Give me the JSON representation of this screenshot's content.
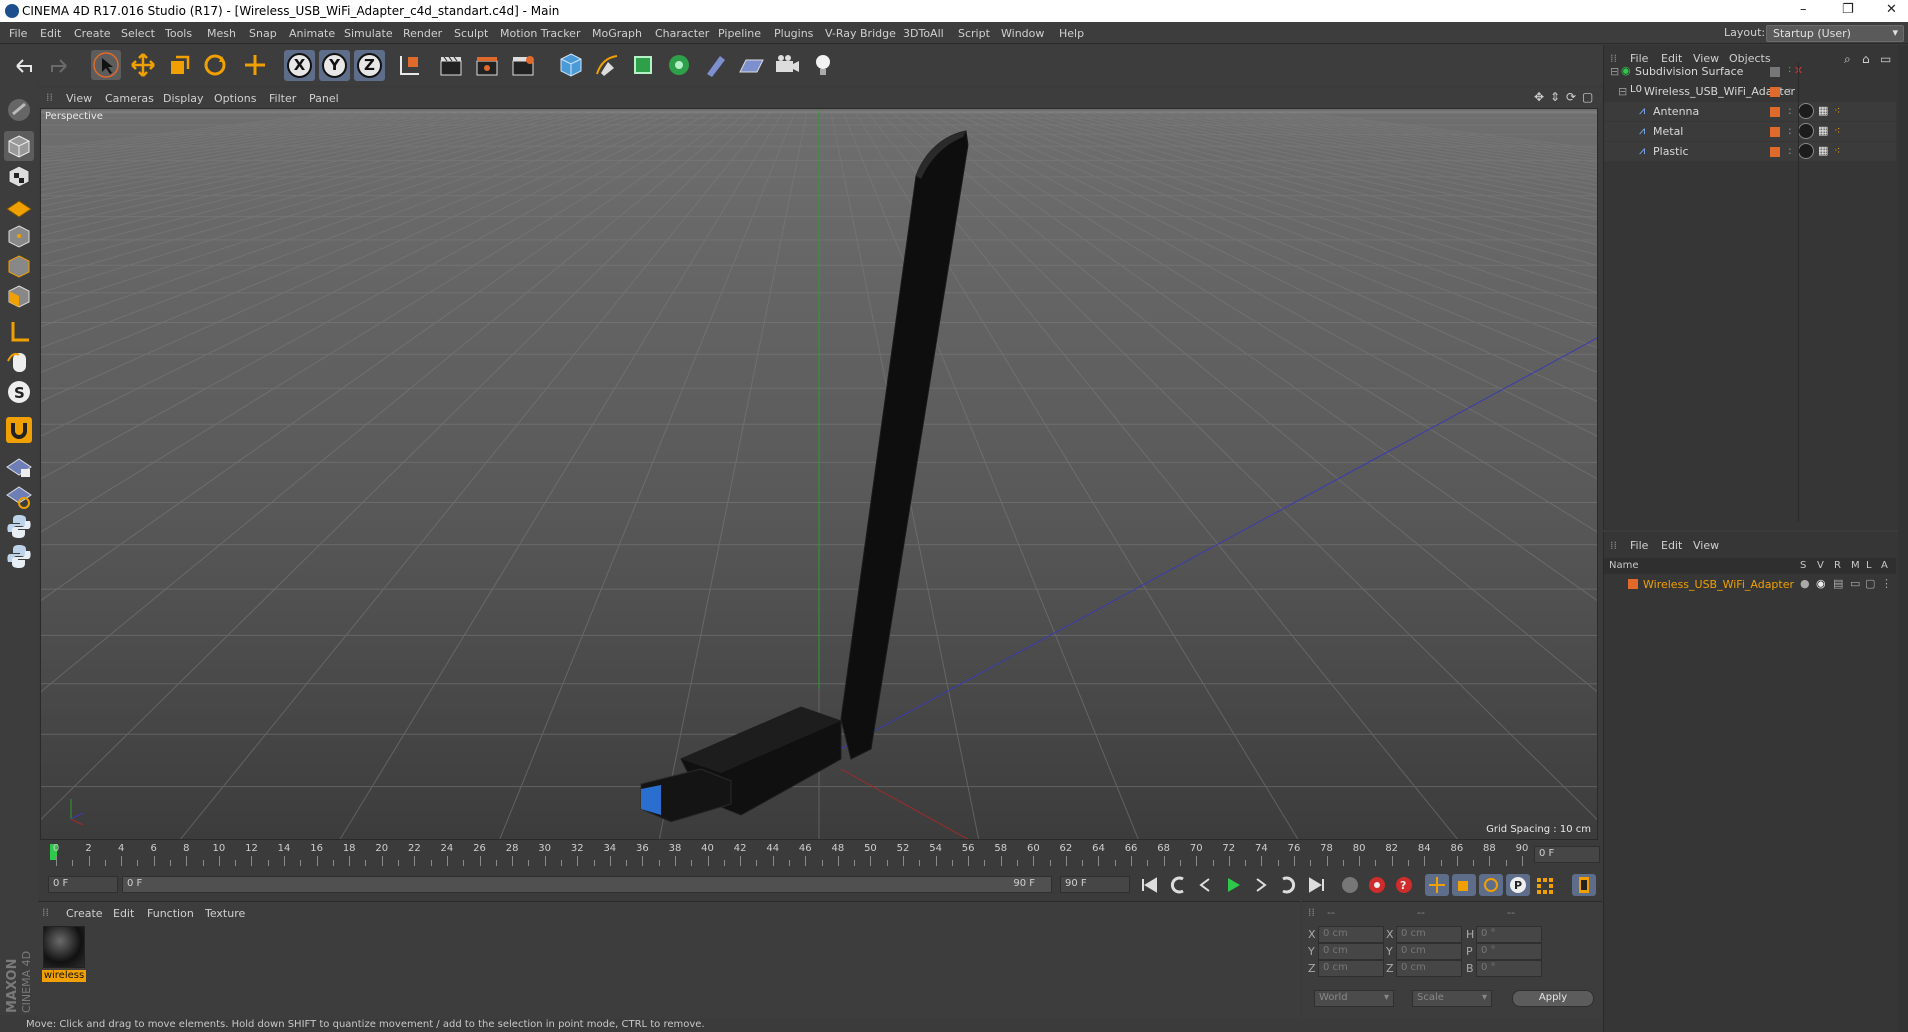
{
  "window": {
    "title": "CINEMA 4D R17.016 Studio (R17) - [Wireless_USB_WiFi_Adapter_c4d_standart.c4d] - Main",
    "controls": [
      "–",
      "❐",
      "✕"
    ]
  },
  "menu": [
    "File",
    "Edit",
    "Create",
    "Select",
    "Tools",
    "Mesh",
    "Snap",
    "Animate",
    "Simulate",
    "Render",
    "Sculpt",
    "Motion Tracker",
    "MoGraph",
    "Character",
    "Pipeline",
    "Plugins",
    "V-Ray Bridge",
    "3DToAll",
    "Script",
    "Window",
    "Help"
  ],
  "layout": {
    "label": "Layout:",
    "value": "Startup (User)"
  },
  "axes": [
    "X",
    "Y",
    "Z"
  ],
  "viewport": {
    "menu": [
      "View",
      "Cameras",
      "Display",
      "Options",
      "Filter",
      "Panel"
    ],
    "label": "Perspective",
    "grid_spacing": "Grid Spacing : 10 cm"
  },
  "timeline": {
    "ticks": [
      "0",
      "2",
      "4",
      "6",
      "8",
      "10",
      "12",
      "14",
      "16",
      "18",
      "20",
      "22",
      "24",
      "26",
      "28",
      "30",
      "32",
      "34",
      "36",
      "38",
      "40",
      "42",
      "44",
      "46",
      "48",
      "50",
      "52",
      "54",
      "56",
      "58",
      "60",
      "62",
      "64",
      "66",
      "68",
      "70",
      "72",
      "74",
      "76",
      "78",
      "80",
      "82",
      "84",
      "86",
      "88",
      "90"
    ],
    "current_frame": "0 F",
    "start": "0 F",
    "range_start": "0 F",
    "range_end": "90 F",
    "end": "90 F"
  },
  "material_manager": {
    "menu": [
      "Create",
      "Edit",
      "Function",
      "Texture"
    ],
    "material": "wireless"
  },
  "coordinates": {
    "header": [
      "--",
      "--",
      "--"
    ],
    "rows": [
      {
        "a": "X",
        "av": "0 cm",
        "b": "X",
        "bv": "0 cm",
        "c": "H",
        "cv": "0 °"
      },
      {
        "a": "Y",
        "av": "0 cm",
        "b": "Y",
        "bv": "0 cm",
        "c": "P",
        "cv": "0 °"
      },
      {
        "a": "Z",
        "av": "0 cm",
        "b": "Z",
        "bv": "0 cm",
        "c": "B",
        "cv": "0 °"
      }
    ],
    "mode": "World",
    "size_mode": "Scale",
    "apply": "Apply"
  },
  "object_manager": {
    "menu": [
      "File",
      "Edit",
      "View",
      "Objects"
    ],
    "objects": [
      "Subdivision Surface",
      "Wireless_USB_WiFi_Adapter",
      "Antenna",
      "Metal",
      "Plastic"
    ]
  },
  "attribute_manager": {
    "menu": [
      "File",
      "Edit",
      "View"
    ],
    "columns": [
      "Name",
      "S",
      "V",
      "R",
      "M",
      "L",
      "A"
    ],
    "layer": "Wireless_USB_WiFi_Adapter"
  },
  "brand": {
    "maxon": "MAXON",
    "product": "CINEMA 4D"
  },
  "status": "Move: Click and drag to move elements. Hold down SHIFT to quantize movement / add to the selection in point mode, CTRL to remove.",
  "colors": {
    "accent": "#f0a000",
    "layer_color": "#e06a2b",
    "play": "#2ec84a"
  }
}
